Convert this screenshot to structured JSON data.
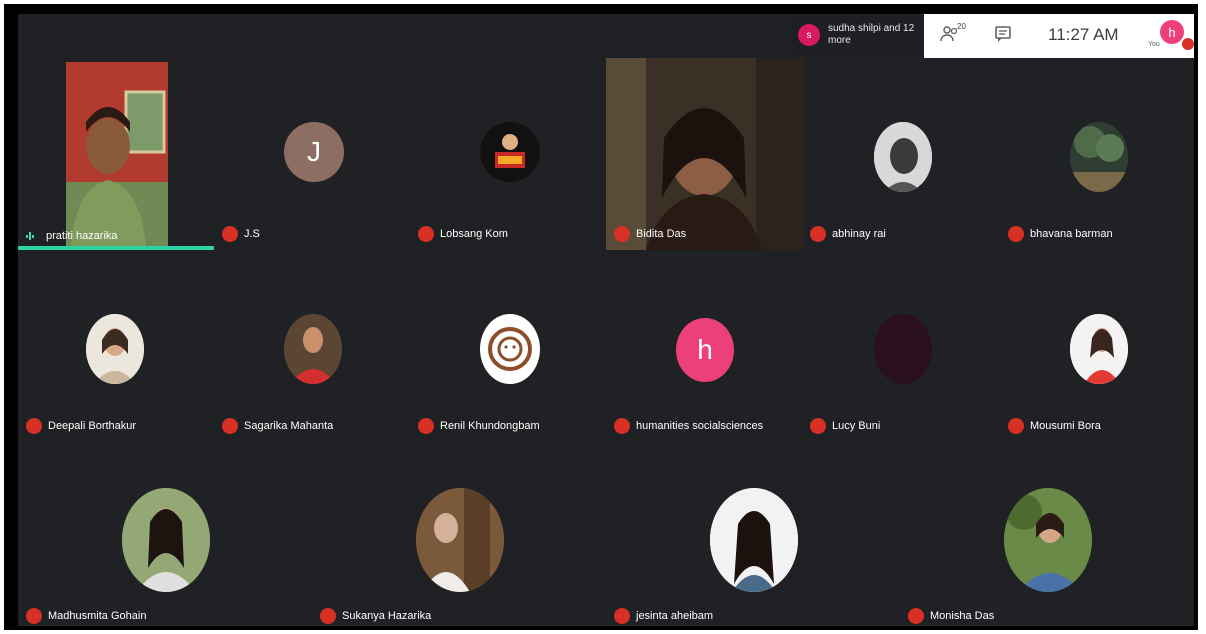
{
  "topbar": {
    "join_toast": {
      "avatar_initial": "s",
      "text": "sudha shilpi and 12 more"
    },
    "people_count": "20",
    "clock": "11:27 AM",
    "you_label": "You",
    "self_avatar_initial": "h"
  },
  "participants": [
    {
      "name": "pratiti hazarika",
      "type": "video"
    },
    {
      "name": "J.S",
      "initial": "J"
    },
    {
      "name": "Lobsang Kom"
    },
    {
      "name": "Bidita Das",
      "type": "video"
    },
    {
      "name": "abhinay rai"
    },
    {
      "name": "bhavana barman"
    },
    {
      "name": "Deepali Borthakur"
    },
    {
      "name": "Sagarika Mahanta"
    },
    {
      "name": "Renil Khundongbam"
    },
    {
      "name": "humanities socialsciences",
      "initial": "h"
    },
    {
      "name": "Lucy Buni"
    },
    {
      "name": "Mousumi Bora"
    },
    {
      "name": "Madhusmita Gohain"
    },
    {
      "name": "Sukanya Hazarika"
    },
    {
      "name": "jesinta aheibam"
    },
    {
      "name": "Monisha Das"
    }
  ],
  "colors": {
    "background": "#202124",
    "mic_muted": "#d93025",
    "active_speaker": "#2bd3a3",
    "js_avatar": "#8d6e63",
    "h_avatar": "#ec407a"
  }
}
